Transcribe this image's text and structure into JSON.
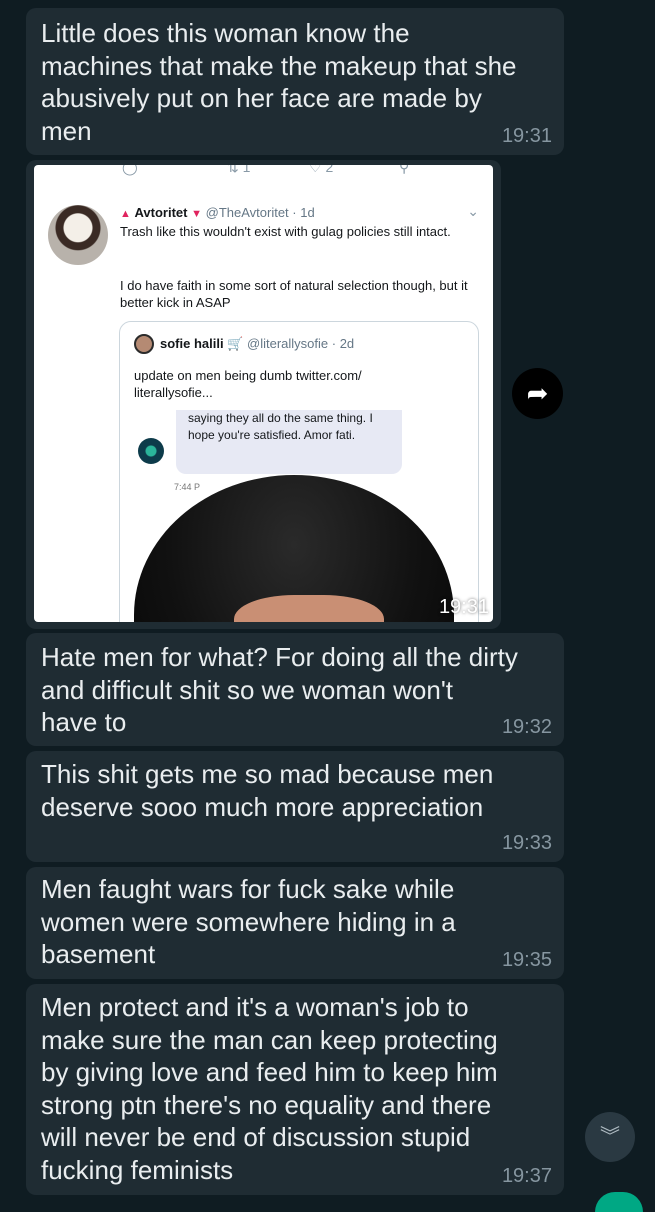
{
  "messages": [
    {
      "text": "Little does this woman know the\nmachines that make the makeup that she\nabusively put on her face are made by\nmen",
      "time": "19:31"
    },
    {
      "text": "Hate men for what? For doing all the dirty\nand difficult shit so we woman won't\nhave to",
      "time": "19:32"
    },
    {
      "text": "This shit gets me so mad because men\ndeserve sooo much more appreciation",
      "time": "19:33"
    },
    {
      "text": "Men faught wars for fuck sake while\nwomen were somewhere hiding in a\nbasement",
      "time": "19:35"
    },
    {
      "text": "Men protect and it's a woman's job to\nmake sure the man can keep protecting\nby giving love and feed him to keep him\nstrong ptn there's no equality and there\nwill never be end of discussion stupid\nfucking feminists",
      "time": "19:37"
    }
  ],
  "image_message": {
    "time": "19:31",
    "tweet": {
      "top_counts": {
        "retweets": "1",
        "likes": "2"
      },
      "author_name": "Avtoritet",
      "author_handle": "@TheAvtoritet",
      "age": "· 1d",
      "text_1": "Trash like this wouldn't exist with gulag policies still intact.",
      "text_2": "I do have faith in some sort of natural selection though, but it better kick in ASAP",
      "quoted": {
        "author_name": "sofie halili",
        "author_handle": "@literallysofie",
        "age": "· 2d",
        "text": "update on men being dumb twitter.com/\nliterallysofie...",
        "dm_text": "saying they all do the same thing. I hope you're satisfied. Amor fati.",
        "dm_time": "7:44 P"
      }
    }
  },
  "icons": {
    "share": "share-forward-icon",
    "scroll": "double-chevron-down-icon"
  }
}
